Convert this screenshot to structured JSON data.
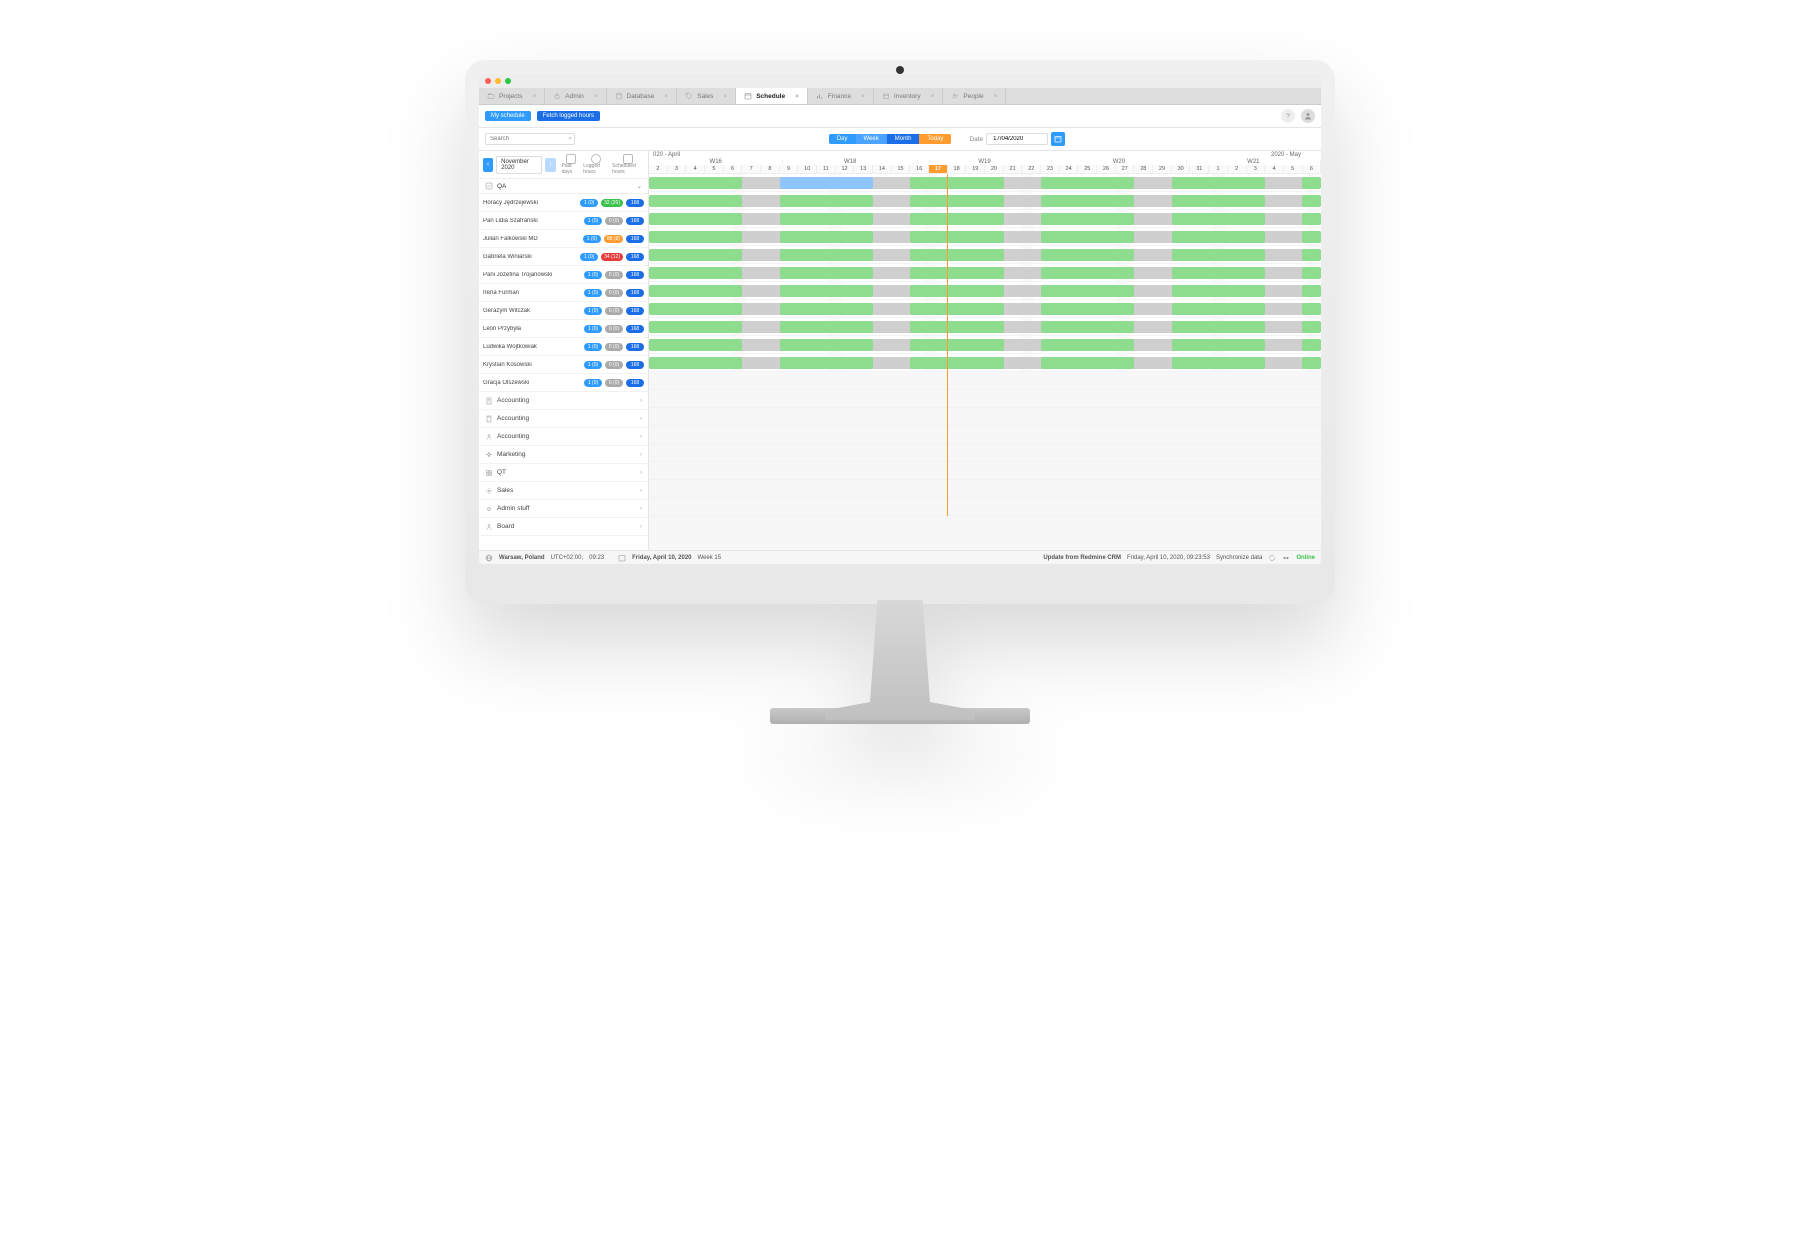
{
  "tabs": [
    {
      "label": "Projects",
      "icon": "folder"
    },
    {
      "label": "Admin",
      "icon": "lock"
    },
    {
      "label": "Database",
      "icon": "db"
    },
    {
      "label": "Sales",
      "icon": "tag"
    },
    {
      "label": "Schedule",
      "icon": "calendar",
      "active": true
    },
    {
      "label": "Finance",
      "icon": "chart"
    },
    {
      "label": "Inventory",
      "icon": "box"
    },
    {
      "label": "People",
      "icon": "people"
    }
  ],
  "toolbar": {
    "my_schedule": "My schedule",
    "fetch": "Fetch logged hours",
    "search_placeholder": "Search",
    "seg": {
      "day": "Day",
      "week": "Week",
      "month": "Month",
      "today": "Today"
    },
    "date_label": "Date",
    "date_value": "17/04/2020"
  },
  "side": {
    "nav_month": "November 2020",
    "cols": {
      "paid": "Paid days",
      "logged": "Logged hours",
      "sched": "Scheduled hours"
    },
    "group": "QA",
    "employees": [
      {
        "name": "Horacy Jędrzejewski",
        "paid": "1 (0)",
        "log": "32 (26)",
        "log_cls": "green",
        "sched": "168"
      },
      {
        "name": "Pan Lidia Szafrański",
        "paid": "1 (0)",
        "log": "0 (0)",
        "log_cls": "",
        "sched": "168"
      },
      {
        "name": "Julian Falkowski MD",
        "paid": "1 (0)",
        "log": "88 (8)",
        "log_cls": "orange",
        "sched": "168"
      },
      {
        "name": "Gabriela Winiarski",
        "paid": "1 (0)",
        "log": "34 (12)",
        "log_cls": "red",
        "sched": "168"
      },
      {
        "name": "Pani Józefina Trojanowski",
        "paid": "1 (0)",
        "log": "0 (0)",
        "log_cls": "",
        "sched": "168"
      },
      {
        "name": "Irena Furman",
        "paid": "1 (0)",
        "log": "0 (0)",
        "log_cls": "",
        "sched": "168"
      },
      {
        "name": "Gerazym Witczak",
        "paid": "1 (0)",
        "log": "0 (0)",
        "log_cls": "",
        "sched": "168"
      },
      {
        "name": "Leon Przybyła",
        "paid": "1 (0)",
        "log": "0 (0)",
        "log_cls": "",
        "sched": "168"
      },
      {
        "name": "Ludwika Wojtkowiak",
        "paid": "1 (0)",
        "log": "0 (0)",
        "log_cls": "",
        "sched": "168"
      },
      {
        "name": "Krystian Kosowski",
        "paid": "1 (0)",
        "log": "0 (0)",
        "log_cls": "",
        "sched": "168"
      },
      {
        "name": "Gracja Olszewski",
        "paid": "1 (0)",
        "log": "0 (0)",
        "log_cls": "",
        "sched": "168"
      }
    ],
    "categories": [
      {
        "label": "Accounting",
        "icon": "doc"
      },
      {
        "label": "Accounting",
        "icon": "calc"
      },
      {
        "label": "Accounting",
        "icon": "person"
      },
      {
        "label": "Marketing",
        "icon": "spark"
      },
      {
        "label": "QT",
        "icon": "grid"
      },
      {
        "label": "Sales",
        "icon": "gear"
      },
      {
        "label": "Admin stuff",
        "icon": "cog"
      },
      {
        "label": "Board",
        "icon": "person"
      }
    ]
  },
  "calendar": {
    "month_left": "020 - April",
    "month_right": "2020 - May",
    "weeks": [
      "W16",
      "W18",
      "W19",
      "W20",
      "W21"
    ],
    "days": [
      "2",
      "3",
      "4",
      "5",
      "6",
      "7",
      "8",
      "9",
      "10",
      "11",
      "12",
      "13",
      "14",
      "15",
      "16",
      "17",
      "18",
      "19",
      "20",
      "21",
      "22",
      "23",
      "24",
      "25",
      "26",
      "27",
      "28",
      "29",
      "30",
      "31",
      "1",
      "2",
      "3",
      "4",
      "5",
      "6"
    ],
    "today_index": 15,
    "today_pct": 44.4
  },
  "footer": {
    "location": "Warsaw, Poland",
    "tz": "UTC+02:00,",
    "time": "09:23",
    "day": "Friday, April 10, 2020",
    "week": "Week 15",
    "update": "Update from Redmine CRM",
    "update_time": "Friday, April 10, 2020, 09:23:53",
    "sync": "Synchronize data",
    "status": "Online"
  }
}
